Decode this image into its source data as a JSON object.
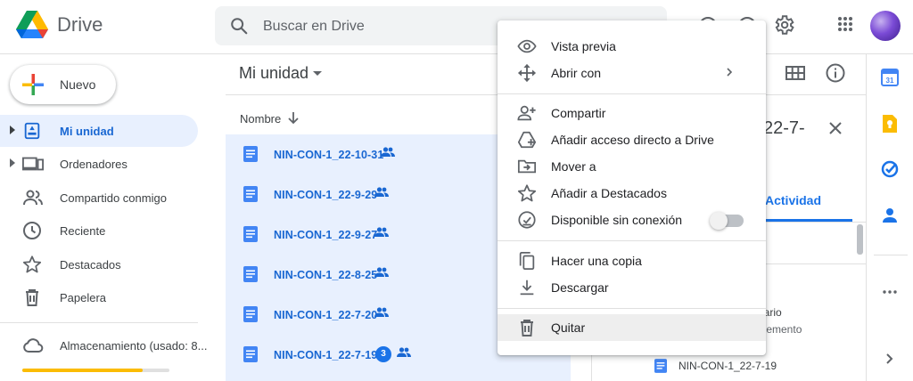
{
  "app": {
    "name": "Drive"
  },
  "search": {
    "placeholder": "Buscar en Drive"
  },
  "sidebar": {
    "new_label": "Nuevo",
    "items": [
      {
        "label": "Mi unidad",
        "icon": "my-drive-icon",
        "active": true
      },
      {
        "label": "Ordenadores",
        "icon": "computers-icon",
        "active": false
      },
      {
        "label": "Compartido conmigo",
        "icon": "shared-with-me-icon",
        "active": false
      },
      {
        "label": "Reciente",
        "icon": "recent-clock-icon",
        "active": false
      },
      {
        "label": "Destacados",
        "icon": "star-icon",
        "active": false
      },
      {
        "label": "Papelera",
        "icon": "trash-icon",
        "active": false
      }
    ],
    "storage": {
      "label": "Almacenamiento (usado: 8...",
      "fill_fraction": 0.82,
      "bar_color": "#fbbc04"
    }
  },
  "main": {
    "breadcrumb": "Mi unidad",
    "column_name": "Nombre",
    "files": [
      {
        "name": "NIN-CON-1_22-10-31",
        "shared": true,
        "badge": ""
      },
      {
        "name": "NIN-CON-1_22-9-29",
        "shared": true,
        "badge": ""
      },
      {
        "name": "NIN-CON-1_22-9-27",
        "shared": true,
        "badge": ""
      },
      {
        "name": "NIN-CON-1_22-8-25",
        "shared": true,
        "badge": ""
      },
      {
        "name": "NIN-CON-1_22-7-20",
        "shared": true,
        "badge": ""
      },
      {
        "name": "NIN-CON-1_22-7-19",
        "shared": true,
        "badge": "3"
      }
    ]
  },
  "details": {
    "title": "22-7-",
    "tab": "Actividad",
    "activity_line1": "uario",
    "activity_line2": "elemento",
    "activity_file": "NIN-CON-1_22-7-19"
  },
  "context_menu": {
    "items": [
      {
        "label": "Vista previa",
        "icon": "eye-icon"
      },
      {
        "label": "Abrir con",
        "icon": "open-with-icon",
        "submenu": true
      },
      {
        "label": "Compartir",
        "icon": "add-person-icon"
      },
      {
        "label": "Añadir acceso directo a Drive",
        "icon": "add-shortcut-icon"
      },
      {
        "label": "Mover a",
        "icon": "move-to-folder-icon"
      },
      {
        "label": "Añadir a Destacados",
        "icon": "star-outline-icon"
      },
      {
        "label": "Disponible sin conexión",
        "icon": "offline-icon",
        "toggle": false
      },
      {
        "label": "Hacer una copia",
        "icon": "copy-icon"
      },
      {
        "label": "Descargar",
        "icon": "download-icon"
      },
      {
        "label": "Quitar",
        "icon": "trash-icon",
        "hover": true
      }
    ]
  },
  "colors": {
    "accent": "#1a73e8",
    "selection": "#e8f0fe",
    "active_text": "#1967d2"
  }
}
